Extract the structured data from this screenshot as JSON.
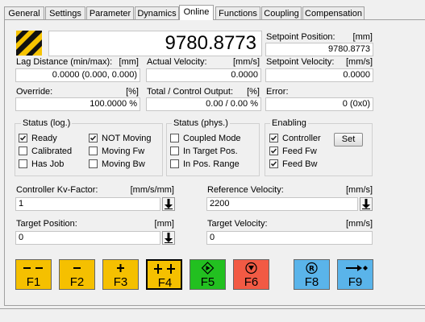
{
  "tabs": [
    {
      "label": "General",
      "active": false
    },
    {
      "label": "Settings",
      "active": false
    },
    {
      "label": "Parameter",
      "active": false
    },
    {
      "label": "Dynamics",
      "active": false
    },
    {
      "label": "Online",
      "active": true
    },
    {
      "label": "Functions",
      "active": false
    },
    {
      "label": "Coupling",
      "active": false
    },
    {
      "label": "Compensation",
      "active": false
    }
  ],
  "actual_position_display": "9780.8773",
  "setpoint_position": {
    "label": "Setpoint Position:",
    "unit": "[mm]",
    "value": "9780.8773"
  },
  "lag_distance": {
    "label": "Lag Distance (min/max):",
    "unit": "[mm]",
    "value": "0.0000  (0.000, 0.000)"
  },
  "actual_velocity": {
    "label": "Actual Velocity:",
    "unit": "[mm/s]",
    "value": "0.0000"
  },
  "setpoint_velocity": {
    "label": "Setpoint Velocity:",
    "unit": "[mm/s]",
    "value": "0.0000"
  },
  "override": {
    "label": "Override:",
    "unit": "[%]",
    "value": "100.0000 %"
  },
  "total_control_output": {
    "label": "Total / Control Output:",
    "unit": "[%]",
    "value": "0.00 /  0.00 %"
  },
  "error": {
    "label": "Error:",
    "value": "0 (0x0)"
  },
  "status_log": {
    "title": "Status (log.)",
    "items": [
      {
        "label": "Ready",
        "checked": true
      },
      {
        "label": "Calibrated",
        "checked": false
      },
      {
        "label": "Has Job",
        "checked": false
      },
      {
        "label": "NOT Moving",
        "checked": true
      },
      {
        "label": "Moving Fw",
        "checked": false
      },
      {
        "label": "Moving Bw",
        "checked": false
      }
    ]
  },
  "status_phys": {
    "title": "Status (phys.)",
    "items": [
      {
        "label": "Coupled Mode",
        "checked": false
      },
      {
        "label": "In Target Pos.",
        "checked": false
      },
      {
        "label": "In Pos. Range",
        "checked": false
      }
    ]
  },
  "enabling": {
    "title": "Enabling",
    "items": [
      {
        "label": "Controller",
        "checked": true
      },
      {
        "label": "Feed Fw",
        "checked": true
      },
      {
        "label": "Feed Bw",
        "checked": true
      }
    ],
    "set_label": "Set"
  },
  "controller_kv": {
    "label": "Controller Kv-Factor:",
    "unit": "[mm/s/mm]",
    "value": "1"
  },
  "reference_velocity": {
    "label": "Reference Velocity:",
    "unit": "[mm/s]",
    "value": "2200"
  },
  "target_position": {
    "label": "Target Position:",
    "unit": "[mm]",
    "value": "0"
  },
  "target_velocity": {
    "label": "Target Velocity:",
    "unit": "[mm/s]",
    "value": "0"
  },
  "function_keys": [
    {
      "label": "F1",
      "icon": "double-minus-icon",
      "color": "#f5c000"
    },
    {
      "label": "F2",
      "icon": "minus-icon",
      "color": "#f5c000"
    },
    {
      "label": "F3",
      "icon": "plus-icon",
      "color": "#f5c000"
    },
    {
      "label": "F4",
      "icon": "double-plus-icon",
      "color": "#f5c000"
    },
    {
      "label": "F5",
      "icon": "diamond-start-icon",
      "color": "#22c020"
    },
    {
      "label": "F6",
      "icon": "stop-circle-icon",
      "color": "#f25a44"
    },
    {
      "label": "F8",
      "icon": "reset-r-icon",
      "color": "#5ab4ea"
    },
    {
      "label": "F9",
      "icon": "arrow-to-target-icon",
      "color": "#5ab4ea"
    }
  ]
}
